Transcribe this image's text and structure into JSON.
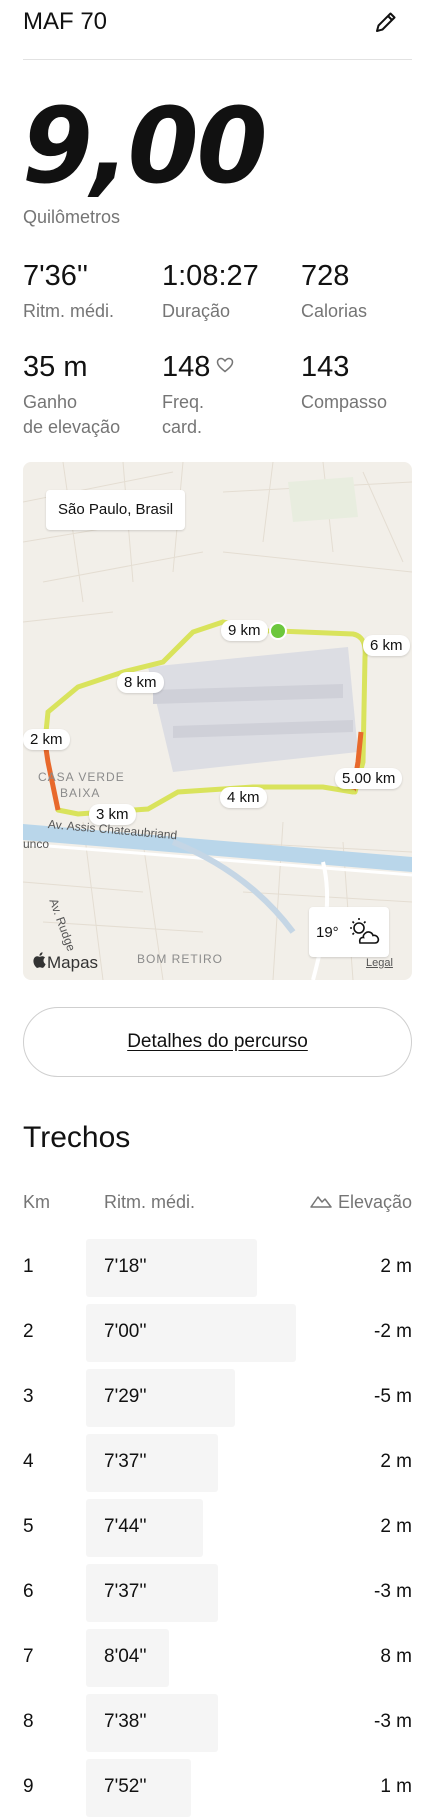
{
  "header": {
    "title": "MAF 70"
  },
  "summary": {
    "distance": "9,00",
    "distance_unit": "Quilômetros"
  },
  "stats": {
    "avg_pace": {
      "value": "7'36''",
      "label": "Ritm. médi."
    },
    "duration": {
      "value": "1:08:27",
      "label": "Duração"
    },
    "calories": {
      "value": "728",
      "label": "Calorias"
    },
    "elevation_gain": {
      "value": "35 m",
      "label_line1": "Ganho",
      "label_line2": "de elevação"
    },
    "heart_rate": {
      "value": "148",
      "label_line1": "Freq.",
      "label_line2": "card."
    },
    "cadence": {
      "value": "143",
      "label": "Compasso"
    }
  },
  "map": {
    "location": "São Paulo, Brasil",
    "markers": [
      "9 km",
      "6 km",
      "8 km",
      "2 km",
      "5.00 km",
      "4 km",
      "3 km"
    ],
    "place_labels": {
      "casa_verde_1": "CASA VERDE",
      "casa_verde_2": "BAIXA",
      "bom_retiro": "BOM RETIRO",
      "street1": "Av. Assis Chateaubriand",
      "street2": "Av. Rudge",
      "street3": "unco"
    },
    "weather": {
      "temp": "19°",
      "icon": "partly-cloudy-icon"
    },
    "brand": "Mapas",
    "legal": "Legal"
  },
  "route_details_button": "Detalhes do percurso",
  "splits": {
    "title": "Trechos",
    "col_km": "Km",
    "col_pace": "Ritm. médi.",
    "col_elevation": "Elevação",
    "rows": [
      {
        "km": "1",
        "pace": "7'18''",
        "elevation": "2 m",
        "bar": 0.7
      },
      {
        "km": "2",
        "pace": "7'00''",
        "elevation": "-2 m",
        "bar": 0.86
      },
      {
        "km": "3",
        "pace": "7'29''",
        "elevation": "-5 m",
        "bar": 0.61
      },
      {
        "km": "4",
        "pace": "7'37''",
        "elevation": "2 m",
        "bar": 0.54
      },
      {
        "km": "5",
        "pace": "7'44''",
        "elevation": "2 m",
        "bar": 0.48
      },
      {
        "km": "6",
        "pace": "7'37''",
        "elevation": "-3 m",
        "bar": 0.54
      },
      {
        "km": "7",
        "pace": "8'04''",
        "elevation": "8 m",
        "bar": 0.34
      },
      {
        "km": "8",
        "pace": "7'38''",
        "elevation": "-3 m",
        "bar": 0.54
      },
      {
        "km": "9",
        "pace": "7'52''",
        "elevation": "1 m",
        "bar": 0.43
      }
    ]
  }
}
